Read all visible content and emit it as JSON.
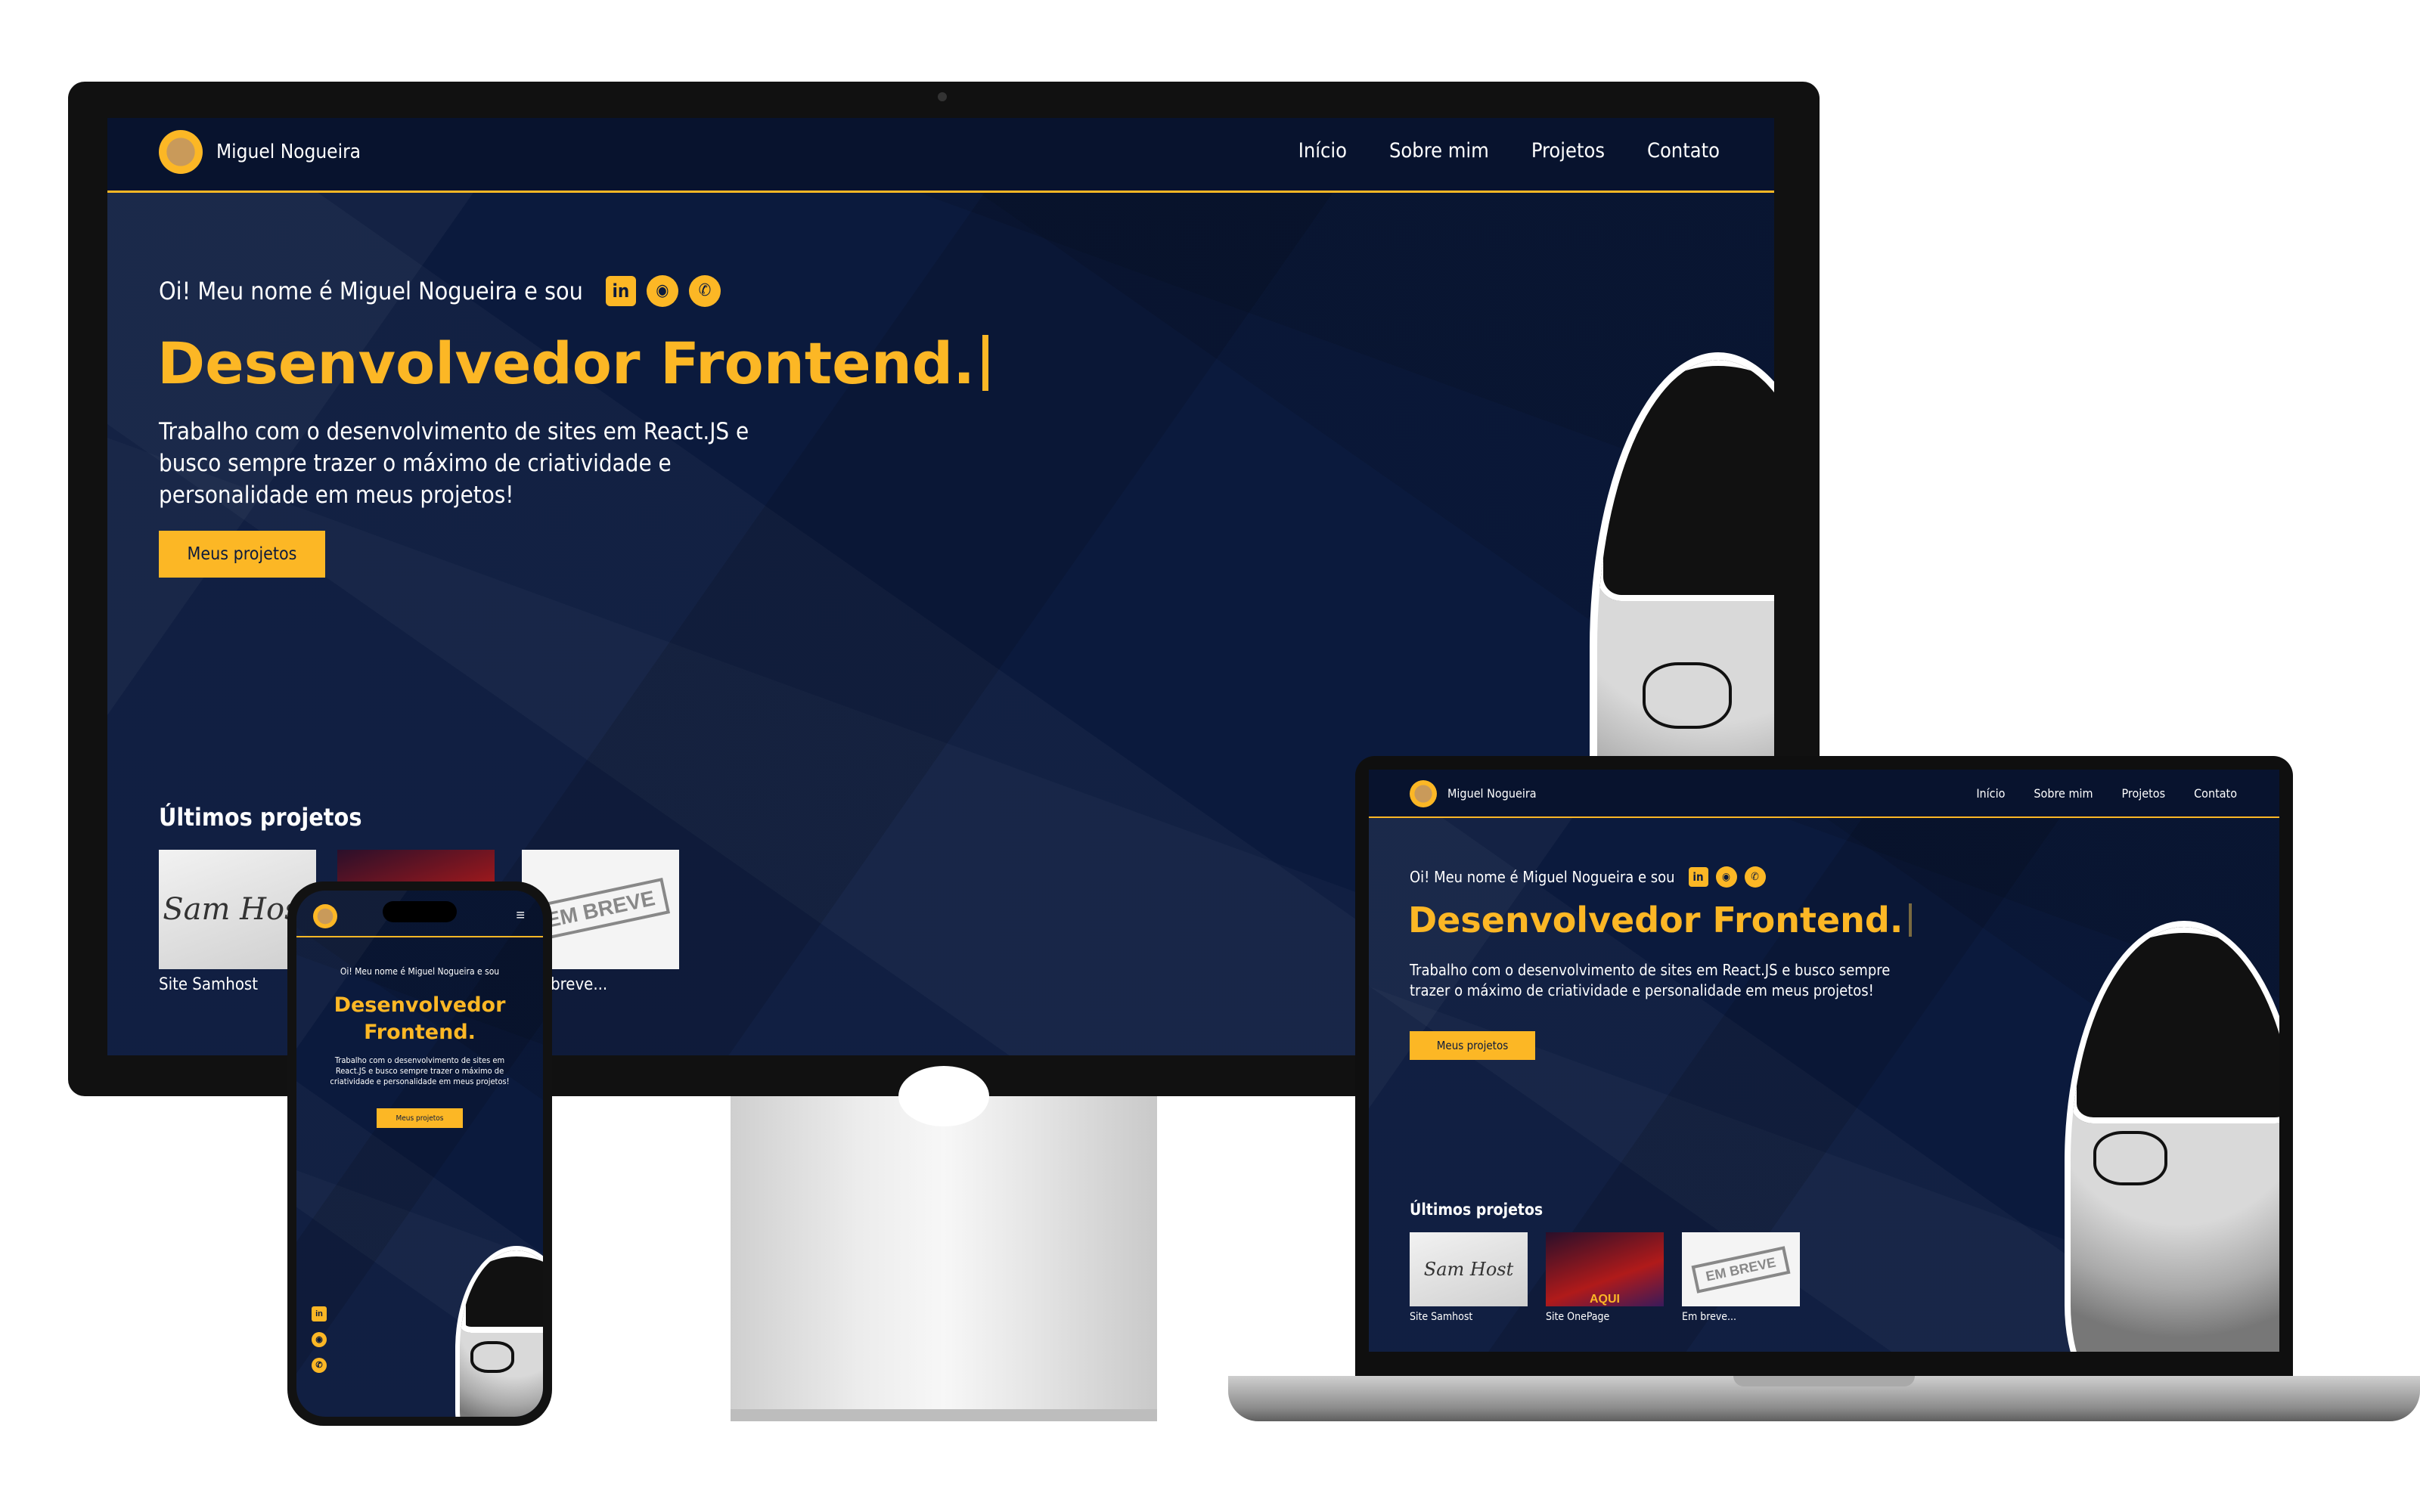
{
  "site": {
    "brand": "Miguel Nogueira",
    "nav": [
      "Início",
      "Sobre mim",
      "Projetos",
      "Contato"
    ],
    "intro": "Oi! Meu nome é Miguel Nogueira e sou",
    "role": "Desenvolvedor Frontend.",
    "description": "Trabalho com o desenvolvimento de sites em React.JS e busco sempre trazer o máximo de criatividade e personalidade em meus projetos!",
    "cta": "Meus projetos",
    "projects_title": "Últimos projetos",
    "projects": [
      {
        "label": "Site Samhost",
        "thumb_text": "Sam Host"
      },
      {
        "label": "Site OnePage",
        "thumb_text": "AQUI"
      },
      {
        "label": "Em breve...",
        "thumb_text": "EM BREVE"
      }
    ],
    "social_icons": [
      "linkedin-icon",
      "github-icon",
      "whatsapp-icon"
    ],
    "colors": {
      "accent": "#fcb725",
      "background": "#0b1a3d",
      "text": "#ffffff"
    }
  }
}
